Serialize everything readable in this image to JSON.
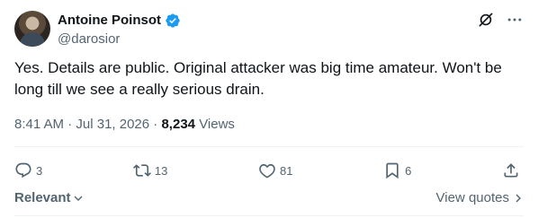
{
  "author": {
    "name": "Antoine Poinsot",
    "handle": "@darosior"
  },
  "tweet": {
    "text": "Yes. Details are public. Original attacker was big time amateur. Won't be long till we see a really serious drain.",
    "time": "8:41 AM",
    "date": "Jul 31, 2026",
    "views_count": "8,234",
    "views_label": "Views"
  },
  "actions": {
    "replies": "3",
    "reposts": "13",
    "likes": "81",
    "bookmarks": "6"
  },
  "footer": {
    "sort_label": "Relevant",
    "view_quotes_label": "View quotes"
  },
  "colors": {
    "verified": "#1d9bf0",
    "muted": "#536471",
    "text": "#0f1419"
  },
  "icons": [
    "verified-badge-icon",
    "grok-icon",
    "more-icon",
    "reply-icon",
    "repost-icon",
    "like-icon",
    "bookmark-icon",
    "share-icon",
    "chevron-down-icon",
    "chevron-right-icon"
  ]
}
